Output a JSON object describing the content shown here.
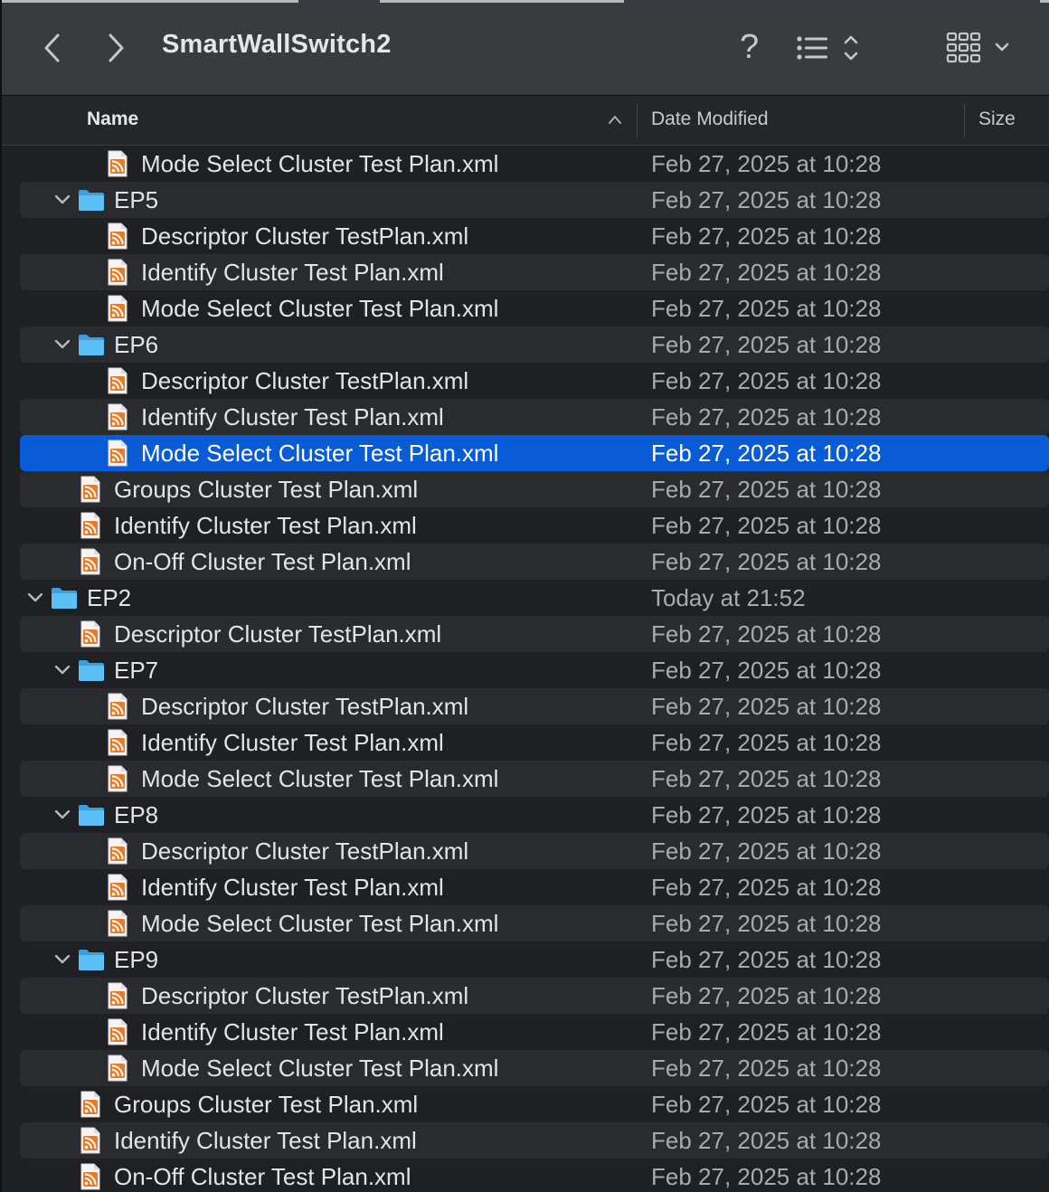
{
  "window": {
    "title": "SmartWallSwitch2"
  },
  "toolbar": {
    "back_icon": "chevron-left-icon",
    "forward_icon": "chevron-right-icon",
    "help_label": "?",
    "list_view_icon": "list-view-icon",
    "grid_view_icon": "grid-view-icon"
  },
  "columns": {
    "name": "Name",
    "date": "Date Modified",
    "size": "Size"
  },
  "rows": [
    {
      "name": "Mode Select Cluster Test Plan.xml",
      "date": "Feb 27, 2025 at 10:28",
      "type": "file",
      "depth": 2
    },
    {
      "name": "EP5",
      "date": "Feb 27, 2025 at 10:28",
      "type": "folder",
      "depth": 1
    },
    {
      "name": "Descriptor Cluster TestPlan.xml",
      "date": "Feb 27, 2025 at 10:28",
      "type": "file",
      "depth": 2
    },
    {
      "name": "Identify Cluster Test Plan.xml",
      "date": "Feb 27, 2025 at 10:28",
      "type": "file",
      "depth": 2
    },
    {
      "name": "Mode Select Cluster Test Plan.xml",
      "date": "Feb 27, 2025 at 10:28",
      "type": "file",
      "depth": 2
    },
    {
      "name": "EP6",
      "date": "Feb 27, 2025 at 10:28",
      "type": "folder",
      "depth": 1
    },
    {
      "name": "Descriptor Cluster TestPlan.xml",
      "date": "Feb 27, 2025 at 10:28",
      "type": "file",
      "depth": 2
    },
    {
      "name": "Identify Cluster Test Plan.xml",
      "date": "Feb 27, 2025 at 10:28",
      "type": "file",
      "depth": 2
    },
    {
      "name": "Mode Select Cluster Test Plan.xml",
      "date": "Feb 27, 2025 at 10:28",
      "type": "file",
      "depth": 2,
      "selected": true
    },
    {
      "name": "Groups Cluster Test Plan.xml",
      "date": "Feb 27, 2025 at 10:28",
      "type": "file",
      "depth": 1
    },
    {
      "name": "Identify Cluster Test Plan.xml",
      "date": "Feb 27, 2025 at 10:28",
      "type": "file",
      "depth": 1
    },
    {
      "name": "On-Off Cluster Test Plan.xml",
      "date": "Feb 27, 2025 at 10:28",
      "type": "file",
      "depth": 1
    },
    {
      "name": "EP2",
      "date": "Today at 21:52",
      "type": "folder",
      "depth": 0
    },
    {
      "name": "Descriptor Cluster TestPlan.xml",
      "date": "Feb 27, 2025 at 10:28",
      "type": "file",
      "depth": 1
    },
    {
      "name": "EP7",
      "date": "Feb 27, 2025 at 10:28",
      "type": "folder",
      "depth": 1
    },
    {
      "name": "Descriptor Cluster TestPlan.xml",
      "date": "Feb 27, 2025 at 10:28",
      "type": "file",
      "depth": 2
    },
    {
      "name": "Identify Cluster Test Plan.xml",
      "date": "Feb 27, 2025 at 10:28",
      "type": "file",
      "depth": 2
    },
    {
      "name": "Mode Select Cluster Test Plan.xml",
      "date": "Feb 27, 2025 at 10:28",
      "type": "file",
      "depth": 2
    },
    {
      "name": "EP8",
      "date": "Feb 27, 2025 at 10:28",
      "type": "folder",
      "depth": 1
    },
    {
      "name": "Descriptor Cluster TestPlan.xml",
      "date": "Feb 27, 2025 at 10:28",
      "type": "file",
      "depth": 2
    },
    {
      "name": "Identify Cluster Test Plan.xml",
      "date": "Feb 27, 2025 at 10:28",
      "type": "file",
      "depth": 2
    },
    {
      "name": "Mode Select Cluster Test Plan.xml",
      "date": "Feb 27, 2025 at 10:28",
      "type": "file",
      "depth": 2
    },
    {
      "name": "EP9",
      "date": "Feb 27, 2025 at 10:28",
      "type": "folder",
      "depth": 1
    },
    {
      "name": "Descriptor Cluster TestPlan.xml",
      "date": "Feb 27, 2025 at 10:28",
      "type": "file",
      "depth": 2
    },
    {
      "name": "Identify Cluster Test Plan.xml",
      "date": "Feb 27, 2025 at 10:28",
      "type": "file",
      "depth": 2
    },
    {
      "name": "Mode Select Cluster Test Plan.xml",
      "date": "Feb 27, 2025 at 10:28",
      "type": "file",
      "depth": 2
    },
    {
      "name": "Groups Cluster Test Plan.xml",
      "date": "Feb 27, 2025 at 10:28",
      "type": "file",
      "depth": 1
    },
    {
      "name": "Identify Cluster Test Plan.xml",
      "date": "Feb 27, 2025 at 10:28",
      "type": "file",
      "depth": 1
    },
    {
      "name": "On-Off Cluster Test Plan.xml",
      "date": "Feb 27, 2025 at 10:28",
      "type": "file",
      "depth": 1
    }
  ],
  "colors": {
    "selection": "#0a5bd6",
    "folder": "#4fb3f0",
    "xml_icon": "#e07a2e"
  }
}
